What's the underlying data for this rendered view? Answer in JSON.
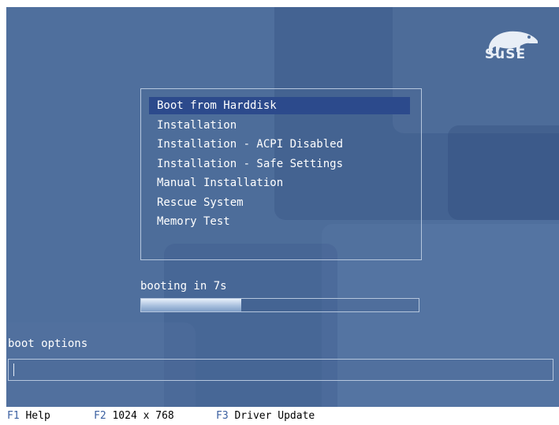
{
  "logo": {
    "text": "SuSE"
  },
  "menu": {
    "items": [
      {
        "label": "Boot from Harddisk",
        "selected": true
      },
      {
        "label": "Installation",
        "selected": false
      },
      {
        "label": "Installation - ACPI Disabled",
        "selected": false
      },
      {
        "label": "Installation - Safe Settings",
        "selected": false
      },
      {
        "label": "Manual Installation",
        "selected": false
      },
      {
        "label": "Rescue System",
        "selected": false
      },
      {
        "label": "Memory Test",
        "selected": false
      }
    ]
  },
  "boot": {
    "countdown_text": "booting in 7s",
    "progress_fraction": 0.36
  },
  "options": {
    "label": "boot options",
    "value": ""
  },
  "fkeys": [
    {
      "key": "F1",
      "label": "Help"
    },
    {
      "key": "F2",
      "label": "1024 x 768"
    },
    {
      "key": "F3",
      "label": "Driver Update"
    }
  ],
  "colors": {
    "background": "#4f6f9d",
    "selection": "#2c4a8c",
    "fkey_accent": "#3a5fa0"
  }
}
